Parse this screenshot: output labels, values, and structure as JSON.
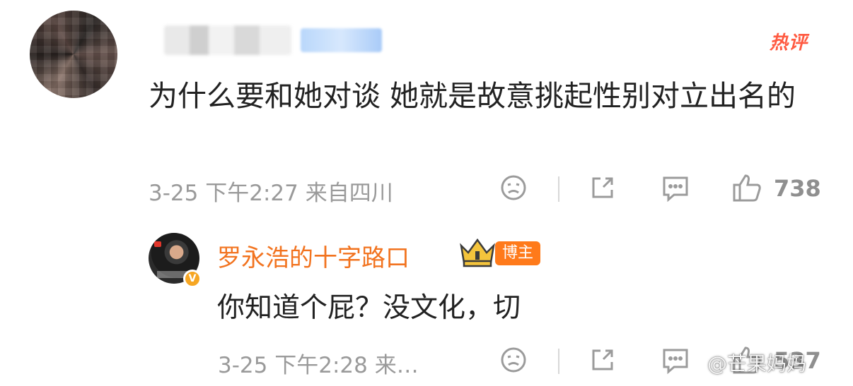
{
  "comment": {
    "hot_label": "热评",
    "text": "为什么要和她对谈  她就是故意挑起性别对立出名的",
    "date": "3-25",
    "time": "下午2:27",
    "location": "来自四川",
    "like_count": "738",
    "actions": [
      "sad-face",
      "share",
      "comment",
      "like"
    ]
  },
  "reply": {
    "author": "罗永浩的十字路口",
    "badge_label": "博主",
    "text": "你知道个屁？没文化，切",
    "date": "3-25",
    "time": "下午2:28",
    "location_truncated": "来…",
    "like_count_partial": "537",
    "verified_mark": "V",
    "actions": [
      "sad-face",
      "share",
      "comment",
      "like"
    ]
  },
  "watermark": "@芒果妈妈",
  "colors": {
    "hot_label": "#ff5a41",
    "author_name": "#f2731f",
    "badge_bg": "#ff7a1a",
    "meta_text": "#9a9a9a"
  }
}
